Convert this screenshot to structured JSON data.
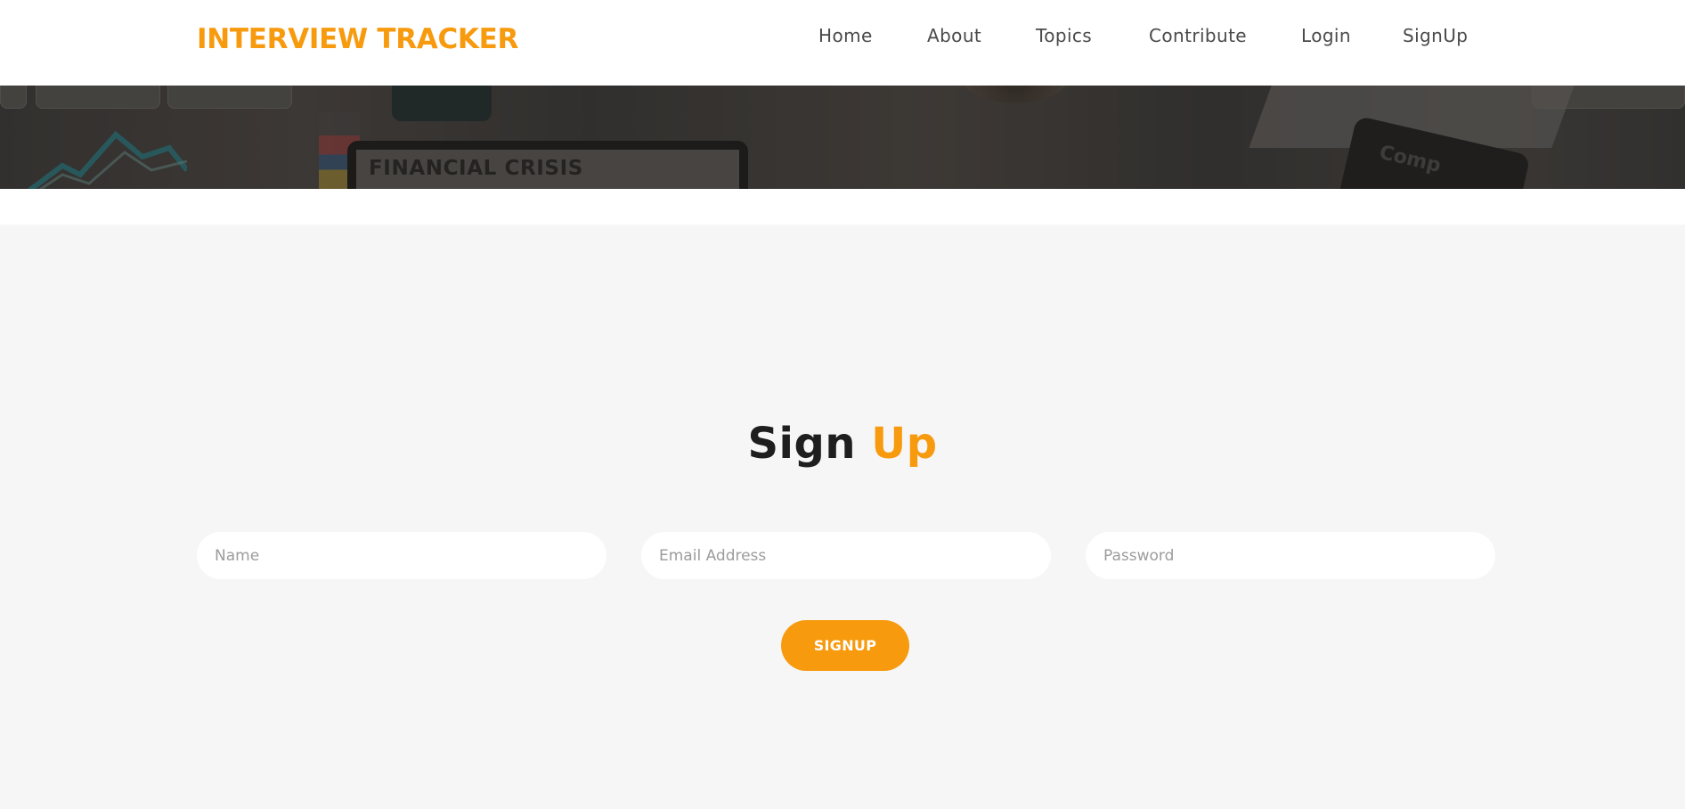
{
  "header": {
    "brand": "INTERVIEW TRACKER",
    "nav": [
      {
        "label": "Home"
      },
      {
        "label": "About"
      },
      {
        "label": "Topics"
      },
      {
        "label": "Contribute"
      },
      {
        "label": "Login"
      },
      {
        "label": "SignUp"
      }
    ]
  },
  "hero": {
    "tablet_text": "FINANCIAL CRISIS",
    "tablet2_text": "Comp"
  },
  "signup": {
    "title_main": "Sign",
    "title_accent": "Up",
    "name_placeholder": "Name",
    "email_placeholder": "Email Address",
    "password_placeholder": "Password",
    "submit_label": "SIGNUP"
  },
  "colors": {
    "accent": "#f79a0e",
    "section_bg": "#f6f6f6",
    "nav_text": "#4a4a4a",
    "title_text": "#1e1e1e"
  }
}
